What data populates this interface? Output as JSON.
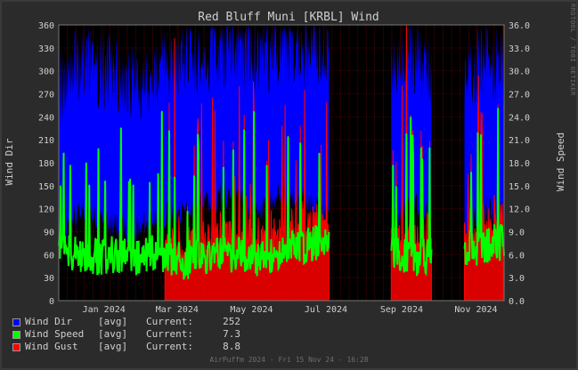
{
  "chart_data": {
    "type": "line",
    "title": "Red Bluff Muni [KRBL] Wind",
    "ylabel": "Wind Dir",
    "y2label": "Wind Speed",
    "ylim": [
      0,
      360
    ],
    "y2lim": [
      0,
      36
    ],
    "yticks": [
      "0",
      "30",
      "60",
      "90",
      "120",
      "150",
      "180",
      "210",
      "240",
      "270",
      "300",
      "330",
      "360"
    ],
    "y2ticks": [
      "0.0",
      "3.0",
      "6.0",
      "9.0",
      "12.0",
      "15.0",
      "18.0",
      "21.0",
      "24.0",
      "27.0",
      "30.0",
      "33.0",
      "36.0"
    ],
    "xlim": [
      "2023-11-25",
      "2024-11-24"
    ],
    "xticks": [
      {
        "date": "2024-01-01",
        "label": "Jan 2024"
      },
      {
        "date": "2024-03-01",
        "label": "Mar 2024"
      },
      {
        "date": "2024-05-01",
        "label": "May 2024"
      },
      {
        "date": "2024-07-01",
        "label": "Jul 2024"
      },
      {
        "date": "2024-09-01",
        "label": "Sep 2024"
      },
      {
        "date": "2024-11-01",
        "label": "Nov 2024"
      }
    ],
    "gaps": [
      [
        "2024-07-04",
        "2024-08-23"
      ],
      [
        "2024-09-26",
        "2024-10-22"
      ]
    ],
    "grid": true,
    "legend_position": "bottom-left",
    "series": [
      {
        "name": "Wind Dir",
        "stat": "[avg]",
        "current": "252",
        "color": "#0000ff",
        "axis": "left",
        "x": [
          "2023-11-25",
          "2023-12-15",
          "2024-01-05",
          "2024-01-25",
          "2024-02-15",
          "2024-03-05",
          "2024-03-25",
          "2024-04-15",
          "2024-05-05",
          "2024-05-25",
          "2024-06-15",
          "2024-07-03",
          "2024-08-23",
          "2024-09-10",
          "2024-09-25",
          "2024-10-22",
          "2024-11-05",
          "2024-11-24"
        ],
        "y": [
          140,
          180,
          160,
          150,
          170,
          180,
          190,
          200,
          180,
          200,
          190,
          170,
          160,
          190,
          170,
          140,
          180,
          170
        ]
      },
      {
        "name": "Wind Speed",
        "stat": "[avg]",
        "current": "7.3",
        "color": "#00ff00",
        "axis": "right",
        "x": [
          "2023-11-25",
          "2023-12-15",
          "2024-01-05",
          "2024-01-25",
          "2024-02-15",
          "2024-03-05",
          "2024-03-25",
          "2024-04-15",
          "2024-05-05",
          "2024-05-25",
          "2024-06-15",
          "2024-07-03",
          "2024-08-23",
          "2024-09-10",
          "2024-09-25",
          "2024-10-22",
          "2024-11-05",
          "2024-11-24"
        ],
        "y": [
          6.5,
          5.0,
          5.5,
          5.0,
          6.0,
          4.5,
          5.5,
          5.5,
          5.0,
          6.0,
          6.5,
          7.5,
          6.0,
          5.0,
          5.5,
          6.0,
          6.5,
          7.3
        ]
      },
      {
        "name": "Wind Gust",
        "stat": "[avg]",
        "current": "8.8",
        "color": "#ff0000",
        "axis": "right",
        "x": [
          "2024-02-20",
          "2024-03-05",
          "2024-03-25",
          "2024-04-15",
          "2024-05-05",
          "2024-05-25",
          "2024-06-15",
          "2024-07-03",
          "2024-08-23",
          "2024-09-10",
          "2024-09-25",
          "2024-10-22",
          "2024-11-05",
          "2024-11-24"
        ],
        "y": [
          7.0,
          7.5,
          7.0,
          7.5,
          7.0,
          8.0,
          8.0,
          9.0,
          7.0,
          6.5,
          7.5,
          8.0,
          8.5,
          8.8
        ]
      }
    ],
    "current_label": "Current:",
    "footer": "AirPuffm 2024 - Fri 15 Nov 24 - 16:28",
    "side_credit": "RRDTOOL / TOBI OETIKER"
  },
  "colors": {
    "background": "#2b2b2b",
    "canvas": "#000000",
    "grid": "#5a0000",
    "text": "#cfcfcf"
  }
}
